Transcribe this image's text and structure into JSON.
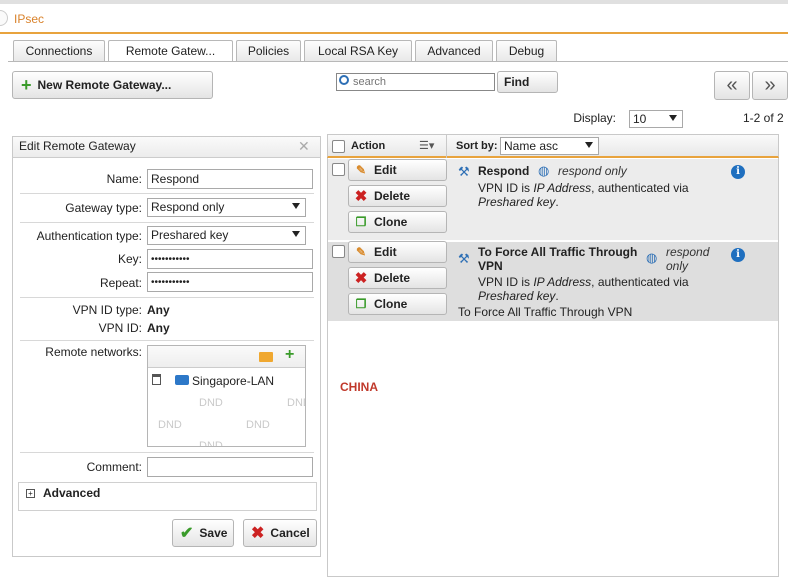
{
  "app": {
    "title": "IPsec"
  },
  "tabs": [
    {
      "label": "Connections"
    },
    {
      "label": "Remote Gatew..."
    },
    {
      "label": "Policies"
    },
    {
      "label": "Local RSA Key"
    },
    {
      "label": "Advanced"
    },
    {
      "label": "Debug"
    }
  ],
  "toolbar": {
    "new_button": "New Remote Gateway...",
    "search_placeholder": "search",
    "find_button": "Find",
    "prev_icon": "«",
    "next_icon": "»",
    "display_label": "Display:",
    "display_value": "10",
    "range": "1-2 of 2"
  },
  "edit_panel": {
    "title": "Edit Remote Gateway",
    "close_icon": "✕",
    "name_label": "Name:",
    "name_value": "Respond",
    "gateway_type_label": "Gateway type:",
    "gateway_type_value": "Respond only",
    "auth_type_label": "Authentication type:",
    "auth_type_value": "Preshared key",
    "key_label": "Key:",
    "key_value": "•••••••••••",
    "repeat_label": "Repeat:",
    "repeat_value": "•••••••••••",
    "vpn_id_type_label": "VPN ID type:",
    "vpn_id_type_value": "Any",
    "vpn_id_label": "VPN ID:",
    "vpn_id_value": "Any",
    "remote_networks_label": "Remote networks:",
    "network_item": "Singapore-LAN",
    "dnd_text": "DND",
    "comment_label": "Comment:",
    "comment_value": "",
    "advanced_label": "Advanced",
    "save_button": "Save",
    "cancel_button": "Cancel"
  },
  "list": {
    "action_header": "Action",
    "sort_label": "Sort by:",
    "sort_value": "Name asc",
    "edit_label": "Edit",
    "delete_label": "Delete",
    "clone_label": "Clone",
    "rows": [
      {
        "name": "Respond",
        "type": "respond only",
        "desc_prefix": "VPN ID is ",
        "desc_italic": "IP Address",
        "desc_mid": ", authenticated via",
        "desc_italic2": "Preshared key",
        "desc_end": ".",
        "comment": ""
      },
      {
        "name": "To Force All Traffic Through VPN",
        "type": "respond only",
        "desc_prefix": "VPN ID is ",
        "desc_italic": "IP Address",
        "desc_mid": ", authenticated via",
        "desc_italic2": "Preshared key",
        "desc_end": ".",
        "comment": "To Force All Traffic Through VPN"
      }
    ]
  },
  "annotation": {
    "text": "CHINA",
    "color": "#c0392b"
  },
  "colors": {
    "accent": "#e8a33d",
    "title": "#d9822b",
    "info": "#1f6fbf",
    "add": "#3a9b2a",
    "delete": "#cc2222"
  }
}
